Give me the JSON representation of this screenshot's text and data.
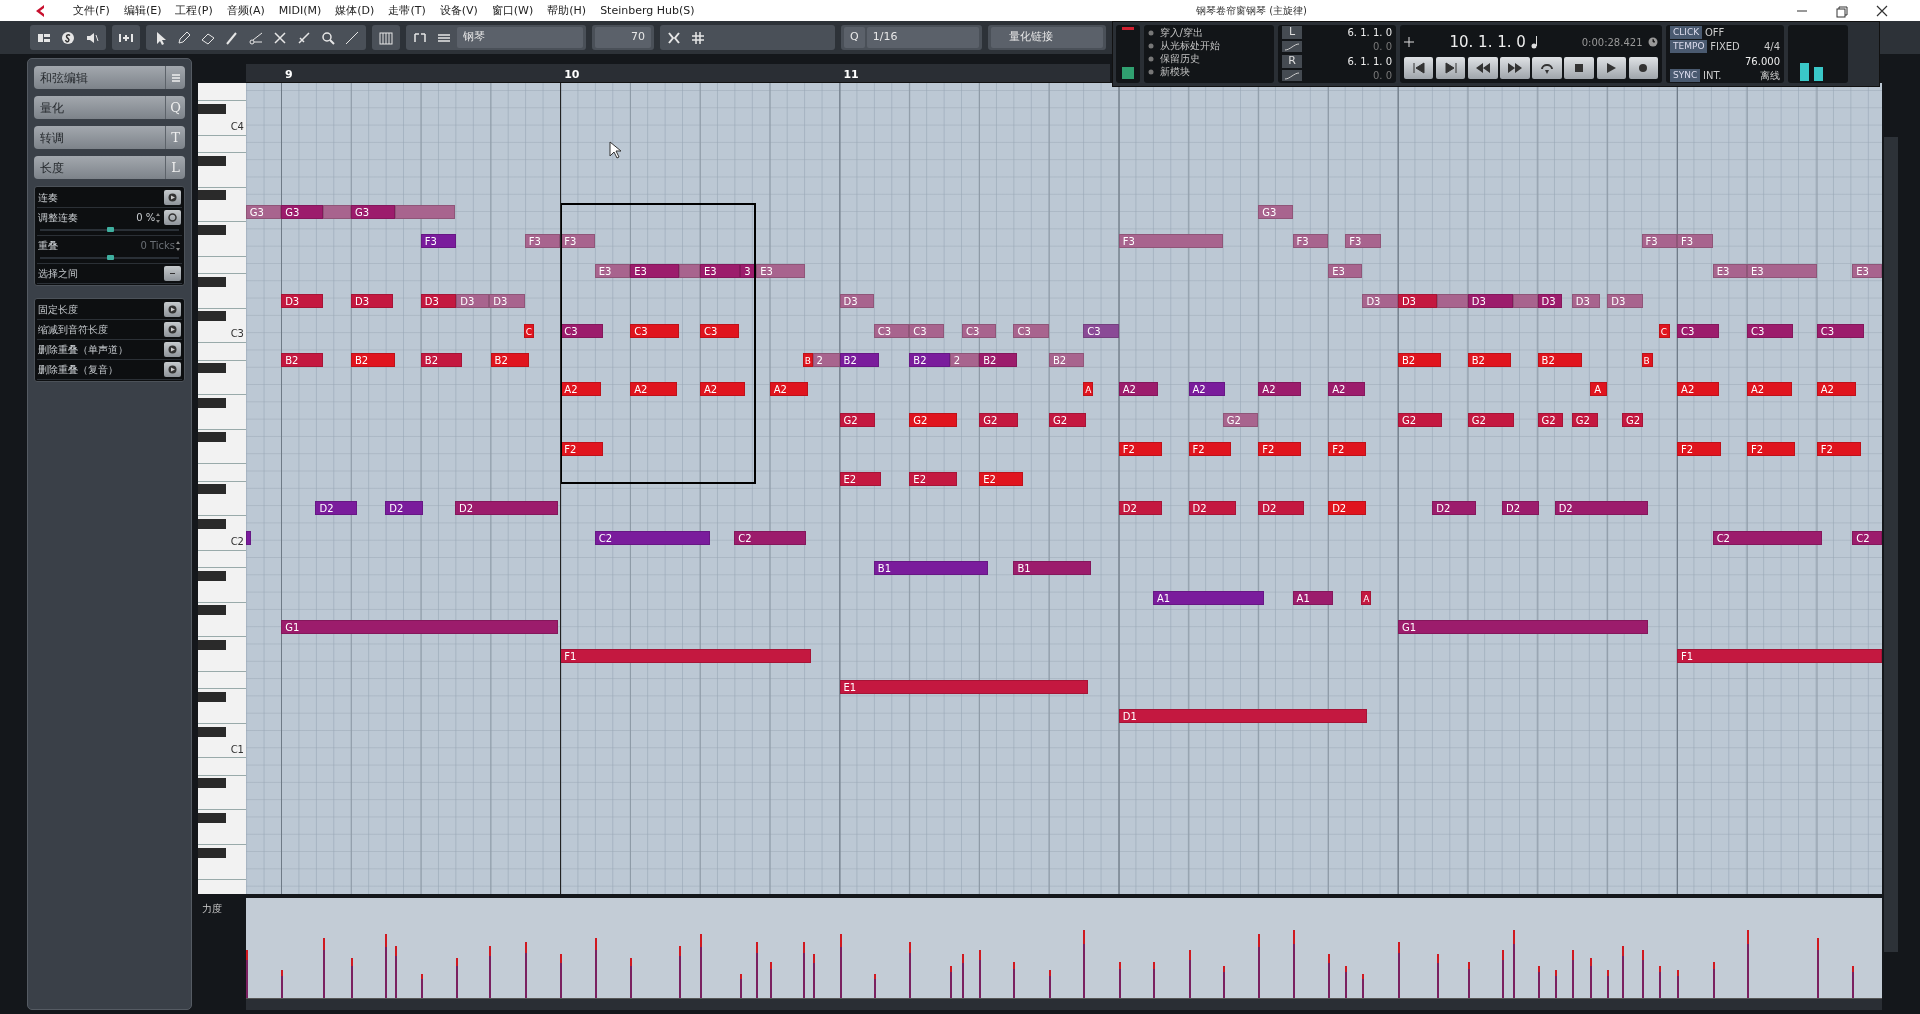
{
  "window": {
    "title": "钢琴卷帘窗钢琴 (主旋律)"
  },
  "menu": [
    "文件(F)",
    "编辑(E)",
    "工程(P)",
    "音频(A)",
    "MIDI(M)",
    "媒体(D)",
    "走带(T)",
    "设备(V)",
    "窗口(W)",
    "帮助(H)",
    "Steinberg Hub(S)"
  ],
  "toolbar": {
    "track": "钢琴",
    "velocity": "70",
    "quantize_label": "Q",
    "quantize": "1/16",
    "quantize_link": "量化链接"
  },
  "transport": {
    "punch": [
      "穿入/穿出",
      "从光标处开始",
      "保留历史",
      "新模块"
    ],
    "locators": [
      {
        "label": "L",
        "position": "6. 1. 1.  0",
        "offset": "0.  0"
      },
      {
        "label": "R",
        "position": "6. 1. 1.  0",
        "offset": "0.  0"
      }
    ],
    "position": "10. 1. 1.   0",
    "time": "0:00:28.421",
    "settings": [
      {
        "label": "CLICK",
        "value": "OFF"
      },
      {
        "label": "TEMPO",
        "value": "FIXED",
        "extra": "4/4",
        "big": "76.000"
      },
      {
        "label": "SYNC",
        "value": "INT.",
        "extra": "离线"
      }
    ]
  },
  "left_panel": {
    "sections": [
      {
        "label": "和弦编辑"
      },
      {
        "label": "量化",
        "key": "Q"
      },
      {
        "label": "转调",
        "key": "T"
      },
      {
        "label": "长度",
        "key": "L"
      }
    ],
    "tools": [
      {
        "label": "连奏",
        "kind": "action"
      },
      {
        "label": "调整连奏",
        "kind": "slider",
        "value": "0 %",
        "level": 0.5,
        "disabled": false
      },
      {
        "label": "重叠",
        "kind": "slider",
        "value": "0 Ticks",
        "level": 0.5,
        "disabled": true
      },
      {
        "label": "选择之间",
        "kind": "dropdown"
      }
    ],
    "tools2": [
      {
        "label": "固定长度",
        "kind": "action"
      },
      {
        "label": "缩减到音符长度",
        "kind": "action"
      },
      {
        "label": "删除重叠（单声道）",
        "kind": "action"
      },
      {
        "label": "删除重叠（复音）",
        "kind": "action"
      }
    ]
  },
  "ruler": [
    "9",
    "10",
    "11"
  ],
  "keyboard": [
    "C4",
    "C3",
    "C2",
    "C1"
  ],
  "velocity_lane": {
    "label": "力度"
  },
  "notes": [
    {
      "label": "G3",
      "color": "#a8648e"
    },
    {
      "label": "G3",
      "color": "#9c1c6c"
    },
    {
      "color": "#a8648e"
    },
    {
      "label": "G3",
      "color": "#9c1c6c"
    },
    {
      "color": "#a8648e"
    },
    {
      "label": "G3",
      "color": "#a8648e"
    },
    {
      "label": "F3",
      "color": "#7a1c9c"
    },
    {
      "label": "F3",
      "color": "#a8648e"
    },
    {
      "label": "F3",
      "color": "#a8648e"
    },
    {
      "label": "F3",
      "color": "#a8648e"
    },
    {
      "label": "F3",
      "color": "#a8648e"
    },
    {
      "label": "F3",
      "color": "#a8648e"
    },
    {
      "label": "F3",
      "color": "#a8648e"
    },
    {
      "label": "F3",
      "color": "#a8648e"
    },
    {
      "label": "E3",
      "color": "#a8648e"
    },
    {
      "label": "E3",
      "color": "#9c1c6c"
    },
    {
      "color": "#a8648e"
    },
    {
      "label": "E3",
      "color": "#9c1c6c"
    },
    {
      "label": "3",
      "color": "#9c1c6c"
    },
    {
      "label": "E3",
      "color": "#a8648e"
    },
    {
      "label": "E3",
      "color": "#a8648e"
    },
    {
      "label": "E3",
      "color": "#a8648e"
    },
    {
      "label": "E3",
      "color": "#a8648e"
    },
    {
      "label": "E3",
      "color": "#a8648e"
    },
    {
      "label": "D3",
      "color": "#c41840"
    },
    {
      "label": "D3",
      "color": "#c41840"
    },
    {
      "label": "D3",
      "color": "#c41840"
    },
    {
      "label": "D3",
      "color": "#a8648e"
    },
    {
      "label": "D3",
      "color": "#a8648e"
    },
    {
      "label": "D3",
      "color": "#a8648e"
    },
    {
      "label": "D3",
      "color": "#a8648e"
    },
    {
      "label": "D3",
      "color": "#c41840"
    },
    {
      "color": "#a8648e"
    },
    {
      "label": "D3",
      "color": "#9c1c6c"
    },
    {
      "color": "#a8648e"
    },
    {
      "label": "D3",
      "color": "#9c1c6c"
    },
    {
      "label": "D3",
      "color": "#a8648e"
    },
    {
      "label": "D3",
      "color": "#a8648e"
    },
    {
      "label": "C",
      "color": "#e0141e"
    },
    {
      "label": "C3",
      "color": "#9c1c6c"
    },
    {
      "label": "C3",
      "color": "#e0141e"
    },
    {
      "label": "C3",
      "color": "#e0141e"
    },
    {
      "label": "C3",
      "color": "#a8648e"
    },
    {
      "label": "C3",
      "color": "#a8648e"
    },
    {
      "label": "C3",
      "color": "#a8648e"
    },
    {
      "label": "C3",
      "color": "#a8648e"
    },
    {
      "label": "C3",
      "color": "#8a4a96"
    },
    {
      "label": "C",
      "color": "#e0141e"
    },
    {
      "label": "C3",
      "color": "#9c1c6c"
    },
    {
      "label": "C3",
      "color": "#9c1c6c"
    },
    {
      "label": "C3",
      "color": "#9c1c6c"
    },
    {
      "label": "B2",
      "color": "#c41840"
    },
    {
      "label": "B2",
      "color": "#e0141e"
    },
    {
      "label": "B2",
      "color": "#c41840"
    },
    {
      "label": "B2",
      "color": "#e0141e"
    },
    {
      "label": "B",
      "color": "#e0141e"
    },
    {
      "label": "2",
      "color": "#a8648e"
    },
    {
      "label": "B2",
      "color": "#7a1c9c"
    },
    {
      "label": "B2",
      "color": "#7a1c9c"
    },
    {
      "label": "2",
      "color": "#a8648e"
    },
    {
      "label": "B2",
      "color": "#9c1c6c"
    },
    {
      "label": "B2",
      "color": "#a8648e"
    },
    {
      "label": "B2",
      "color": "#e0141e"
    },
    {
      "label": "B2",
      "color": "#e0141e"
    },
    {
      "label": "B2",
      "color": "#e0141e"
    },
    {
      "label": "B",
      "color": "#e0141e"
    },
    {
      "label": "A2",
      "color": "#e0141e"
    },
    {
      "label": "A2",
      "color": "#e0141e"
    },
    {
      "label": "A2",
      "color": "#e0141e"
    },
    {
      "label": "A2",
      "color": "#e0141e"
    },
    {
      "label": "A",
      "color": "#e0141e"
    },
    {
      "label": "A2",
      "color": "#9c1c6c"
    },
    {
      "label": "A2",
      "color": "#7a1c9c"
    },
    {
      "label": "A2",
      "color": "#9c1c6c"
    },
    {
      "label": "A2",
      "color": "#9c1c6c"
    },
    {
      "label": "A",
      "color": "#e0141e"
    },
    {
      "label": "A2",
      "color": "#e0141e"
    },
    {
      "label": "A2",
      "color": "#e0141e"
    },
    {
      "label": "A2",
      "color": "#e0141e"
    },
    {
      "label": "G2",
      "color": "#c41840"
    },
    {
      "label": "G2",
      "color": "#e0141e"
    },
    {
      "label": "G2",
      "color": "#c41840"
    },
    {
      "label": "G2",
      "color": "#c41840"
    },
    {
      "label": "G2",
      "color": "#a8648e"
    },
    {
      "label": "G2",
      "color": "#c41840"
    },
    {
      "label": "G2",
      "color": "#c41840"
    },
    {
      "label": "G2",
      "color": "#c41840"
    },
    {
      "label": "G2",
      "color": "#c41840"
    },
    {
      "label": "G2",
      "color": "#c41840"
    },
    {
      "label": "F2",
      "color": "#e0141e"
    },
    {
      "label": "F2",
      "color": "#e0141e"
    },
    {
      "label": "F2",
      "color": "#e0141e"
    },
    {
      "label": "F2",
      "color": "#e0141e"
    },
    {
      "label": "F2",
      "color": "#e0141e"
    },
    {
      "label": "F2",
      "color": "#e0141e"
    },
    {
      "label": "F2",
      "color": "#e0141e"
    },
    {
      "label": "F2",
      "color": "#e0141e"
    },
    {
      "label": "E2",
      "color": "#c41840"
    },
    {
      "label": "E2",
      "color": "#c41840"
    },
    {
      "label": "E2",
      "color": "#e0141e"
    },
    {
      "label": "D2",
      "color": "#7a1c9c"
    },
    {
      "label": "D2",
      "color": "#7a1c9c"
    },
    {
      "label": "D2",
      "color": "#9c1c6c"
    },
    {
      "label": "D2",
      "color": "#c41840"
    },
    {
      "label": "D2",
      "color": "#c41840"
    },
    {
      "label": "D2",
      "color": "#c41840"
    },
    {
      "label": "D2",
      "color": "#e0141e"
    },
    {
      "label": "D2",
      "color": "#9c1c6c"
    },
    {
      "label": "D2",
      "color": "#9c1c6c"
    },
    {
      "label": "D2",
      "color": "#9c1c6c"
    },
    {
      "color": "#7a1c9c"
    },
    {
      "label": "C2",
      "color": "#7a1c9c"
    },
    {
      "label": "C2",
      "color": "#9c1c6c"
    },
    {
      "label": "C2",
      "color": "#9c1c6c"
    },
    {
      "label": "C2",
      "color": "#9c1c6c"
    },
    {
      "label": "B1",
      "color": "#7a1c9c"
    },
    {
      "label": "B1",
      "color": "#9c1c6c"
    },
    {
      "label": "A1",
      "color": "#7a1c9c"
    },
    {
      "label": "A1",
      "color": "#9c1c6c"
    },
    {
      "label": "A",
      "color": "#c41840"
    },
    {
      "label": "G1",
      "color": "#9c1c6c"
    },
    {
      "label": "G1",
      "color": "#9c1c6c"
    },
    {
      "label": "F1",
      "color": "#c41840"
    },
    {
      "label": "F1",
      "color": "#c41840"
    },
    {
      "label": "E1",
      "color": "#c41840"
    },
    {
      "label": "D1",
      "color": "#c41840"
    }
  ]
}
